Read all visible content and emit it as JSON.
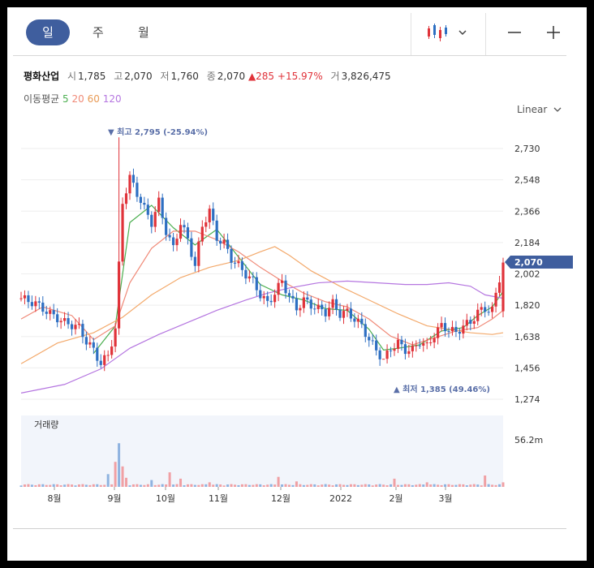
{
  "tabs": [
    {
      "label": "일"
    },
    {
      "label": "주"
    },
    {
      "label": "월"
    }
  ],
  "stock": {
    "name": "평화산업",
    "open_label": "시",
    "open": "1,785",
    "high_label": "고",
    "high": "2,070",
    "low_label": "저",
    "low": "1,760",
    "close_label": "종",
    "close": "2,070",
    "change": "▲285",
    "change_pct": "+15.97%",
    "volume_label": "거",
    "volume": "3,826,475"
  },
  "ma": {
    "label": "이동평균",
    "p5": "5",
    "p20": "20",
    "p60": "60",
    "p120": "120"
  },
  "scale_label": "Linear",
  "icons": {
    "chart_type": "candlestick-icon",
    "dropdown": "chevron-down-icon",
    "zoom_out": "minus-icon",
    "zoom_in": "plus-icon"
  },
  "colors": {
    "up": "#e0333a",
    "down": "#2e6fc2",
    "ma5": "#4caf50",
    "ma20": "#f08a78",
    "ma60": "#f3a96b",
    "ma120": "#b576e0",
    "accent": "#3f5e9e"
  },
  "chart_data": {
    "type": "candlestick",
    "y_ticks": [
      "2,730",
      "2,548",
      "2,366",
      "2,184",
      "2,002",
      "1,820",
      "1,638",
      "1,456",
      "1,274"
    ],
    "ylim": [
      1274,
      2730
    ],
    "x_labels": [
      "8월",
      "9월",
      "10월",
      "11월",
      "12월",
      "2022",
      "2월",
      "3월"
    ],
    "current_price": "2,070",
    "max_annotation": "▼ 최고 2,795 (-25.94%)",
    "min_annotation": "▲ 최저 1,385 (49.46%)",
    "volume_title": "거래량",
    "volume_max_label": "56.2m",
    "close_path": [
      [
        0,
        1860
      ],
      [
        4,
        1830
      ],
      [
        8,
        1770
      ],
      [
        12,
        1720
      ],
      [
        16,
        1690
      ],
      [
        18,
        1610
      ],
      [
        20,
        1560
      ],
      [
        22,
        1480
      ],
      [
        24,
        1530
      ],
      [
        26,
        1680
      ],
      [
        28,
        2420
      ],
      [
        30,
        2560
      ],
      [
        32,
        2470
      ],
      [
        34,
        2380
      ],
      [
        36,
        2300
      ],
      [
        38,
        2420
      ],
      [
        40,
        2250
      ],
      [
        42,
        2150
      ],
      [
        44,
        2300
      ],
      [
        46,
        2200
      ],
      [
        48,
        2050
      ],
      [
        50,
        2280
      ],
      [
        52,
        2370
      ],
      [
        54,
        2210
      ],
      [
        56,
        2180
      ],
      [
        58,
        2090
      ],
      [
        60,
        2050
      ],
      [
        62,
        2000
      ],
      [
        64,
        1960
      ],
      [
        66,
        1880
      ],
      [
        68,
        1830
      ],
      [
        70,
        1890
      ],
      [
        72,
        1960
      ],
      [
        74,
        1870
      ],
      [
        76,
        1800
      ],
      [
        78,
        1850
      ],
      [
        80,
        1820
      ],
      [
        82,
        1800
      ],
      [
        84,
        1780
      ],
      [
        86,
        1830
      ],
      [
        88,
        1770
      ],
      [
        90,
        1780
      ],
      [
        92,
        1740
      ],
      [
        94,
        1700
      ],
      [
        96,
        1620
      ],
      [
        98,
        1560
      ],
      [
        100,
        1500
      ],
      [
        102,
        1570
      ],
      [
        104,
        1600
      ],
      [
        106,
        1560
      ],
      [
        108,
        1560
      ],
      [
        110,
        1610
      ],
      [
        112,
        1580
      ],
      [
        114,
        1650
      ],
      [
        116,
        1700
      ],
      [
        118,
        1680
      ],
      [
        120,
        1660
      ],
      [
        122,
        1700
      ],
      [
        124,
        1720
      ],
      [
        126,
        1780
      ],
      [
        128,
        1800
      ],
      [
        130,
        1790
      ],
      [
        133,
        2070
      ]
    ],
    "ma5_path": [
      [
        20,
        1540
      ],
      [
        26,
        1700
      ],
      [
        30,
        2300
      ],
      [
        36,
        2400
      ],
      [
        42,
        2270
      ],
      [
        48,
        2170
      ],
      [
        54,
        2260
      ],
      [
        60,
        2100
      ],
      [
        66,
        1940
      ],
      [
        72,
        1880
      ],
      [
        78,
        1850
      ],
      [
        84,
        1800
      ],
      [
        90,
        1790
      ],
      [
        96,
        1680
      ],
      [
        100,
        1560
      ],
      [
        104,
        1570
      ],
      [
        110,
        1590
      ],
      [
        116,
        1670
      ],
      [
        122,
        1690
      ],
      [
        126,
        1760
      ],
      [
        130,
        1810
      ],
      [
        133,
        1900
      ]
    ],
    "ma20_path": [
      [
        0,
        1740
      ],
      [
        6,
        1810
      ],
      [
        14,
        1760
      ],
      [
        20,
        1620
      ],
      [
        26,
        1700
      ],
      [
        30,
        1950
      ],
      [
        36,
        2150
      ],
      [
        42,
        2250
      ],
      [
        48,
        2250
      ],
      [
        54,
        2200
      ],
      [
        60,
        2130
      ],
      [
        66,
        2040
      ],
      [
        72,
        1960
      ],
      [
        78,
        1890
      ],
      [
        84,
        1840
      ],
      [
        90,
        1810
      ],
      [
        96,
        1740
      ],
      [
        102,
        1640
      ],
      [
        108,
        1590
      ],
      [
        114,
        1630
      ],
      [
        120,
        1670
      ],
      [
        126,
        1690
      ],
      [
        130,
        1740
      ],
      [
        133,
        1790
      ]
    ],
    "ma60_path": [
      [
        0,
        1480
      ],
      [
        10,
        1600
      ],
      [
        20,
        1660
      ],
      [
        28,
        1750
      ],
      [
        36,
        1880
      ],
      [
        44,
        1980
      ],
      [
        52,
        2040
      ],
      [
        60,
        2080
      ],
      [
        66,
        2130
      ],
      [
        70,
        2160
      ],
      [
        74,
        2110
      ],
      [
        80,
        2020
      ],
      [
        88,
        1930
      ],
      [
        96,
        1850
      ],
      [
        104,
        1770
      ],
      [
        112,
        1700
      ],
      [
        118,
        1680
      ],
      [
        124,
        1660
      ],
      [
        130,
        1650
      ],
      [
        133,
        1660
      ]
    ],
    "ma120_path": [
      [
        0,
        1310
      ],
      [
        12,
        1360
      ],
      [
        22,
        1450
      ],
      [
        30,
        1570
      ],
      [
        38,
        1650
      ],
      [
        46,
        1720
      ],
      [
        54,
        1790
      ],
      [
        62,
        1850
      ],
      [
        68,
        1890
      ],
      [
        74,
        1920
      ],
      [
        82,
        1950
      ],
      [
        90,
        1960
      ],
      [
        98,
        1950
      ],
      [
        106,
        1940
      ],
      [
        112,
        1940
      ],
      [
        118,
        1950
      ],
      [
        124,
        1930
      ],
      [
        128,
        1880
      ],
      [
        133,
        1860
      ]
    ],
    "volume_spikes": [
      [
        24,
        0.28
      ],
      [
        26,
        0.55
      ],
      [
        27,
        0.96
      ],
      [
        28,
        0.45
      ],
      [
        29,
        0.2
      ],
      [
        36,
        0.15
      ],
      [
        41,
        0.32
      ],
      [
        44,
        0.18
      ],
      [
        52,
        0.1
      ],
      [
        71,
        0.22
      ],
      [
        76,
        0.12
      ],
      [
        103,
        0.18
      ],
      [
        112,
        0.1
      ],
      [
        128,
        0.25
      ],
      [
        133,
        0.1
      ]
    ]
  }
}
